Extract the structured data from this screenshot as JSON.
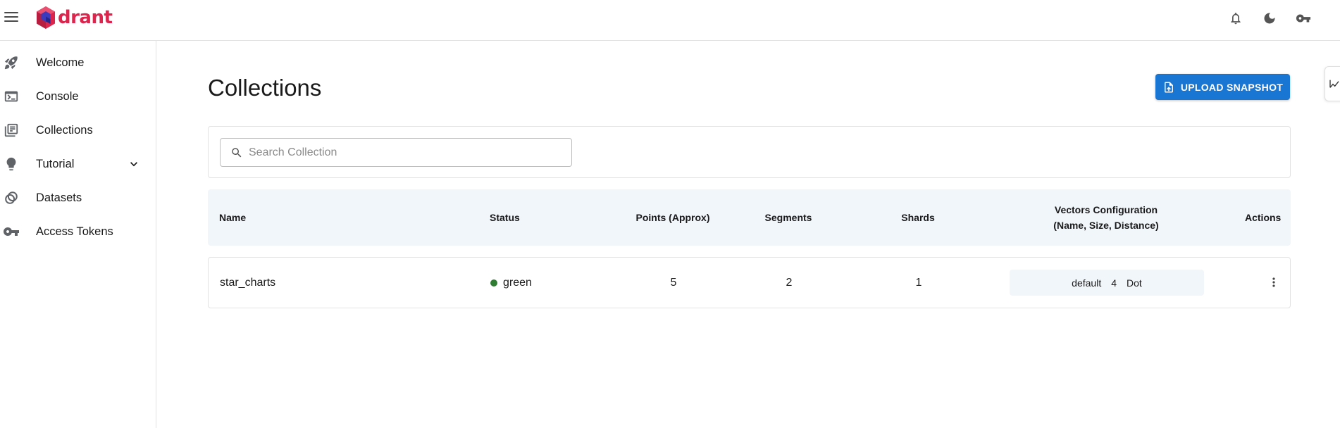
{
  "app": {
    "logo_text": "drant",
    "brand_color": "#dc244c",
    "accent_color": "#1976d2"
  },
  "header": {
    "icons": [
      "bell-icon",
      "moon-icon",
      "key-icon"
    ]
  },
  "sidebar": {
    "items": [
      {
        "label": "Welcome",
        "icon": "rocket-icon"
      },
      {
        "label": "Console",
        "icon": "terminal-icon"
      },
      {
        "label": "Collections",
        "icon": "library-icon"
      },
      {
        "label": "Tutorial",
        "icon": "lightbulb-icon",
        "expandable": true
      },
      {
        "label": "Datasets",
        "icon": "datasets-icon"
      },
      {
        "label": "Access Tokens",
        "icon": "key-icon"
      }
    ]
  },
  "main": {
    "title": "Collections",
    "upload_button": "UPLOAD SNAPSHOT",
    "search": {
      "placeholder": "Search Collection",
      "value": ""
    },
    "table": {
      "headers": {
        "name": "Name",
        "status": "Status",
        "points": "Points (Approx)",
        "segments": "Segments",
        "shards": "Shards",
        "vectors_line1": "Vectors Configuration",
        "vectors_line2": "(Name, Size, Distance)",
        "actions": "Actions"
      },
      "rows": [
        {
          "name": "star_charts",
          "status": "green",
          "status_color": "#2e7d32",
          "points": "5",
          "segments": "2",
          "shards": "1",
          "vector_name": "default",
          "vector_size": "4",
          "vector_distance": "Dot"
        }
      ]
    }
  }
}
